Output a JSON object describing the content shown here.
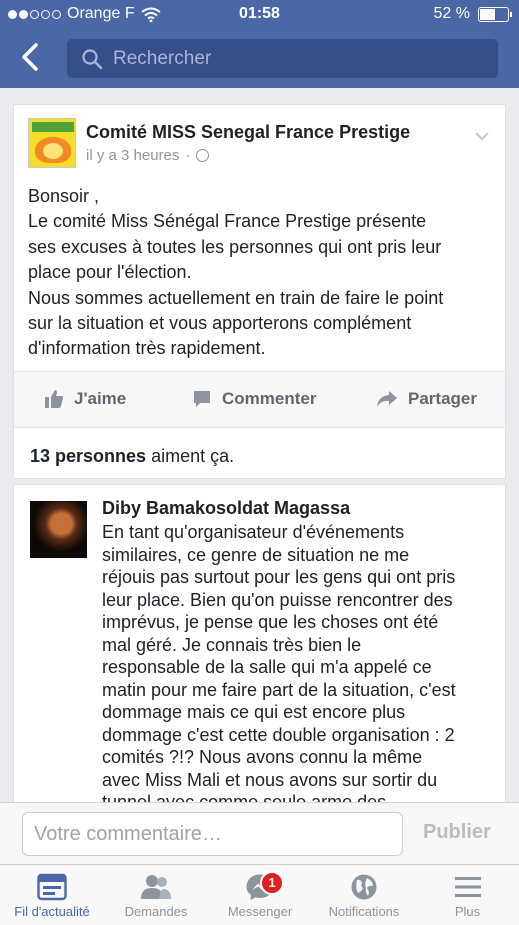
{
  "status_bar": {
    "carrier": "Orange F",
    "time": "01:58",
    "battery": "52 %",
    "signal_bars_filled": 2,
    "signal_bars_total": 5,
    "battery_level": 0.52
  },
  "nav": {
    "search_placeholder": "Rechercher"
  },
  "post": {
    "page_name": "Comité MISS Senegal France Prestige",
    "time_ago": "il y a 3 heures",
    "separator": "·",
    "text_lines": [
      "Bonsoir ,",
      "Le comité Miss Sénégal France Prestige présente",
      "ses excuses à toutes les personnes qui ont pris leur",
      "place pour l'élection.",
      "Nous sommes actuellement en train de faire le point",
      "sur la situation et vous apporterons complément",
      "d'information très rapidement."
    ],
    "actions": {
      "like": "J'aime",
      "comment": "Commenter",
      "share": "Partager"
    },
    "likes_count": "13 personnes",
    "likes_suffix": " aiment ça."
  },
  "comment": {
    "author": "Diby Bamakosoldat Magassa",
    "text_lines": [
      "En tant qu'organisateur d'événements",
      "similaires, ce genre de situation ne me",
      "réjouis pas surtout pour les gens qui ont pris",
      "leur place. Bien qu'on puisse rencontrer des",
      "imprévus, je pense que les choses ont été",
      "mal géré. Je connais très bien le",
      "responsable de la salle qui m'a appelé ce",
      "matin pour me faire part de la situation, c'est",
      "dommage mais ce qui est encore plus",
      "dommage c'est cette double organisation : 2",
      "comités ?!? Nous avons connu la même",
      "avec Miss Mali et nous avons sur sortir du",
      "tunnel avec comme seule arme des"
    ]
  },
  "composer": {
    "placeholder": "Votre commentaire…",
    "publish_label": "Publier"
  },
  "tabs": [
    {
      "label": "Fil d'actualité",
      "icon": "news-feed-icon",
      "active": true
    },
    {
      "label": "Demandes",
      "icon": "friend-requests-icon",
      "active": false
    },
    {
      "label": "Messenger",
      "icon": "messenger-icon",
      "active": false,
      "badge": "1"
    },
    {
      "label": "Notifications",
      "icon": "globe-icon",
      "active": false
    },
    {
      "label": "Plus",
      "icon": "menu-icon",
      "active": false
    }
  ],
  "colors": {
    "brand": "#4b67a5",
    "search_bg": "#364f8a",
    "badge": "#e02020",
    "tab_inactive": "#8d949e"
  }
}
